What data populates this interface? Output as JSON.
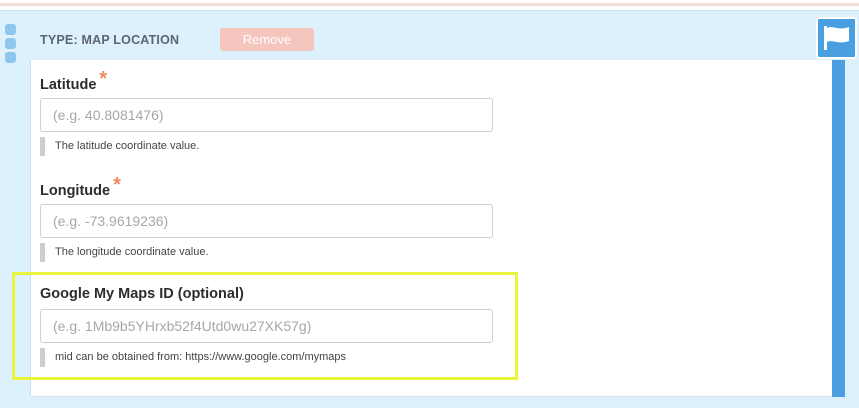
{
  "header": {
    "type_label": "TYPE: MAP LOCATION",
    "remove_label": "Remove"
  },
  "fields": [
    {
      "label": "Latitude",
      "required_mark": "*",
      "placeholder": "(e.g. 40.8081476)",
      "help": "The latitude coordinate value."
    },
    {
      "label": "Longitude",
      "required_mark": "*",
      "placeholder": "(e.g. -73.9619236)",
      "help": "The longitude coordinate value."
    },
    {
      "label": "Google My Maps ID (optional)",
      "placeholder": "(e.g. 1Mb9b5YHrxb52f4Utd0wu27XK57g)",
      "help": "mid can be obtained from: https://www.google.com/mymaps"
    }
  ],
  "icons": {
    "flag": "flag-icon",
    "drag": "drag-handle-icon"
  },
  "colors": {
    "panel": "#dcf1fb",
    "accent": "#4a9fe0",
    "remove": "#f5c6be",
    "required": "#ef8a5c",
    "highlight": "#e9f53c"
  }
}
